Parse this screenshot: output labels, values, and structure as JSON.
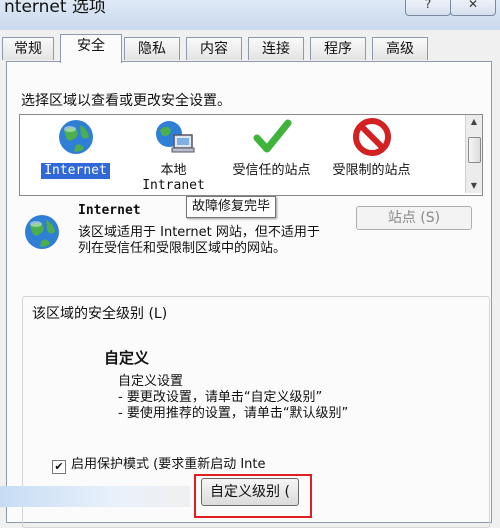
{
  "window": {
    "title": "nternet 选项",
    "help_button": "?",
    "close_button": "✕"
  },
  "tabs": [
    {
      "label": "常规"
    },
    {
      "label": "安全",
      "active": true
    },
    {
      "label": "隐私"
    },
    {
      "label": "内容"
    },
    {
      "label": "连接"
    },
    {
      "label": "程序"
    },
    {
      "label": "高级"
    }
  ],
  "zone_prompt": "选择区域以查看或更改安全设置。",
  "zones": [
    {
      "label": "Internet",
      "icon": "globe-icon",
      "selected": true
    },
    {
      "label": "本地 Intranet",
      "icon": "local-intranet-icon"
    },
    {
      "label": "受信任的站点",
      "icon": "checkmark-icon"
    },
    {
      "label": "受限制的站点",
      "icon": "restricted-icon"
    }
  ],
  "tooltip": "故障修复完毕",
  "sites_button": "站点 (S)",
  "zone_description": {
    "title": "Internet",
    "text": "该区域适用于 Internet 网站，但不适用于列在受信任和受限制区域中的网站。"
  },
  "security_level": {
    "legend": "该区域的安全级别 (L)",
    "name": "自定义",
    "lines": [
      "自定义设置",
      "- 要更改设置，请单击“自定义级别”",
      "- 要使用推荐的设置，请单击“默认级别”"
    ]
  },
  "protected_mode": {
    "label": "启用保护模式 (要求重新启动 Inte",
    "checked": true
  },
  "custom_level_button": "自定义级别 (",
  "colors": {
    "selection": "#3068d8",
    "highlight_border": "#e02020",
    "trusted_check": "#3fb33a",
    "restricted_red": "#d32020"
  }
}
